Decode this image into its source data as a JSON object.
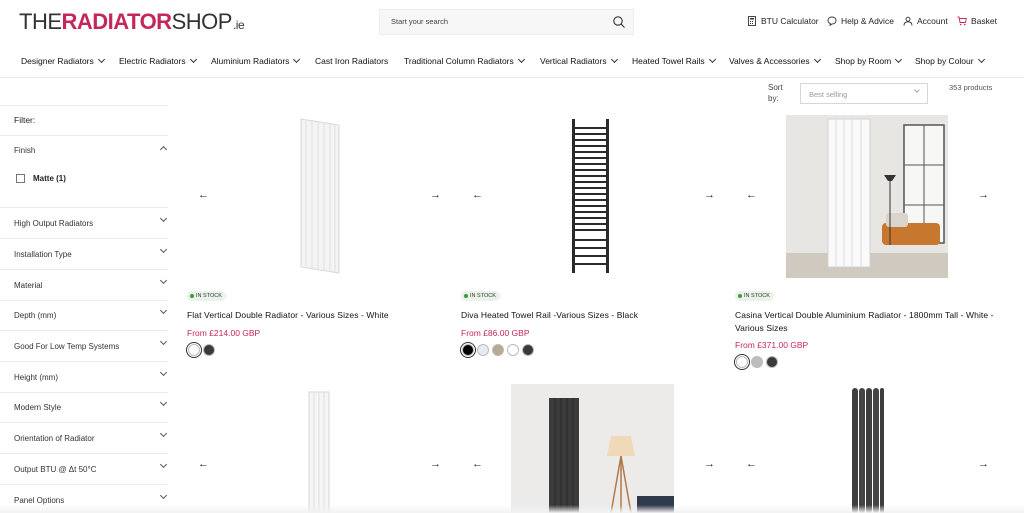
{
  "header": {
    "logo": {
      "the": "THE",
      "radiator": "RADIATOR",
      "shop": "SHOP",
      "ie": ".ie"
    },
    "search_placeholder": "Start your search",
    "utilities": [
      {
        "icon": "calculator-icon",
        "label": "BTU Calculator"
      },
      {
        "icon": "chat-icon",
        "label": "Help & Advice"
      },
      {
        "icon": "user-icon",
        "label": "Account"
      },
      {
        "icon": "basket-icon",
        "label": "Basket"
      }
    ]
  },
  "nav": [
    {
      "label": "Designer Radiators",
      "has_dropdown": true
    },
    {
      "label": "Electric Radiators",
      "has_dropdown": true
    },
    {
      "label": "Aluminium Radiators",
      "has_dropdown": true
    },
    {
      "label": "Cast Iron Radiators",
      "has_dropdown": false
    },
    {
      "label": "Traditional Column Radiators",
      "has_dropdown": true
    },
    {
      "label": "Vertical Radiators",
      "has_dropdown": true
    },
    {
      "label": "Heated Towel Rails",
      "has_dropdown": true
    },
    {
      "label": "Valves & Accessories",
      "has_dropdown": true
    },
    {
      "label": "Shop by Room",
      "has_dropdown": true
    },
    {
      "label": "Shop by Colour",
      "has_dropdown": true
    }
  ],
  "sort": {
    "label": "Sort by:",
    "selected": "Best selling",
    "count": "353 products"
  },
  "filters": {
    "title": "Filter:",
    "open_group": {
      "label": "Finish",
      "options": [
        {
          "label": "Matte (1)",
          "checked": false
        }
      ]
    },
    "groups": [
      "High Output Radiators",
      "Installation Type",
      "Material",
      "Depth (mm)",
      "Good For Low Temp Systems",
      "Height (mm)",
      "Modern Style",
      "Orientation of Radiator",
      "Output BTU @ Δt 50°C",
      "Panel Options"
    ]
  },
  "products": [
    {
      "badge": "IN STOCK",
      "title": "Flat Vertical Double Radiator - Various Sizes - White",
      "price": "From £214.00 GBP",
      "swatches": [
        "#ffffff",
        "#3a3a3a"
      ]
    },
    {
      "badge": "IN STOCK",
      "title": "Diva Heated Towel Rail -Various Sizes - Black",
      "price": "From £86.00 GBP",
      "swatches": [
        "#000000",
        "#e4ebf3",
        "#b9a894",
        "#ffffff",
        "#3a3a3a"
      ]
    },
    {
      "badge": "IN STOCK",
      "title": "Casina Vertical Double Aluminium Radiator - 1800mm Tall - White - Various Sizes",
      "price": "From £371.00 GBP",
      "swatches": [
        "#ffffff",
        "#bdbdbd",
        "#3a3a3a"
      ]
    }
  ],
  "colors": {
    "brand": "#c5275c",
    "stock_green": "#3c9a3c"
  }
}
